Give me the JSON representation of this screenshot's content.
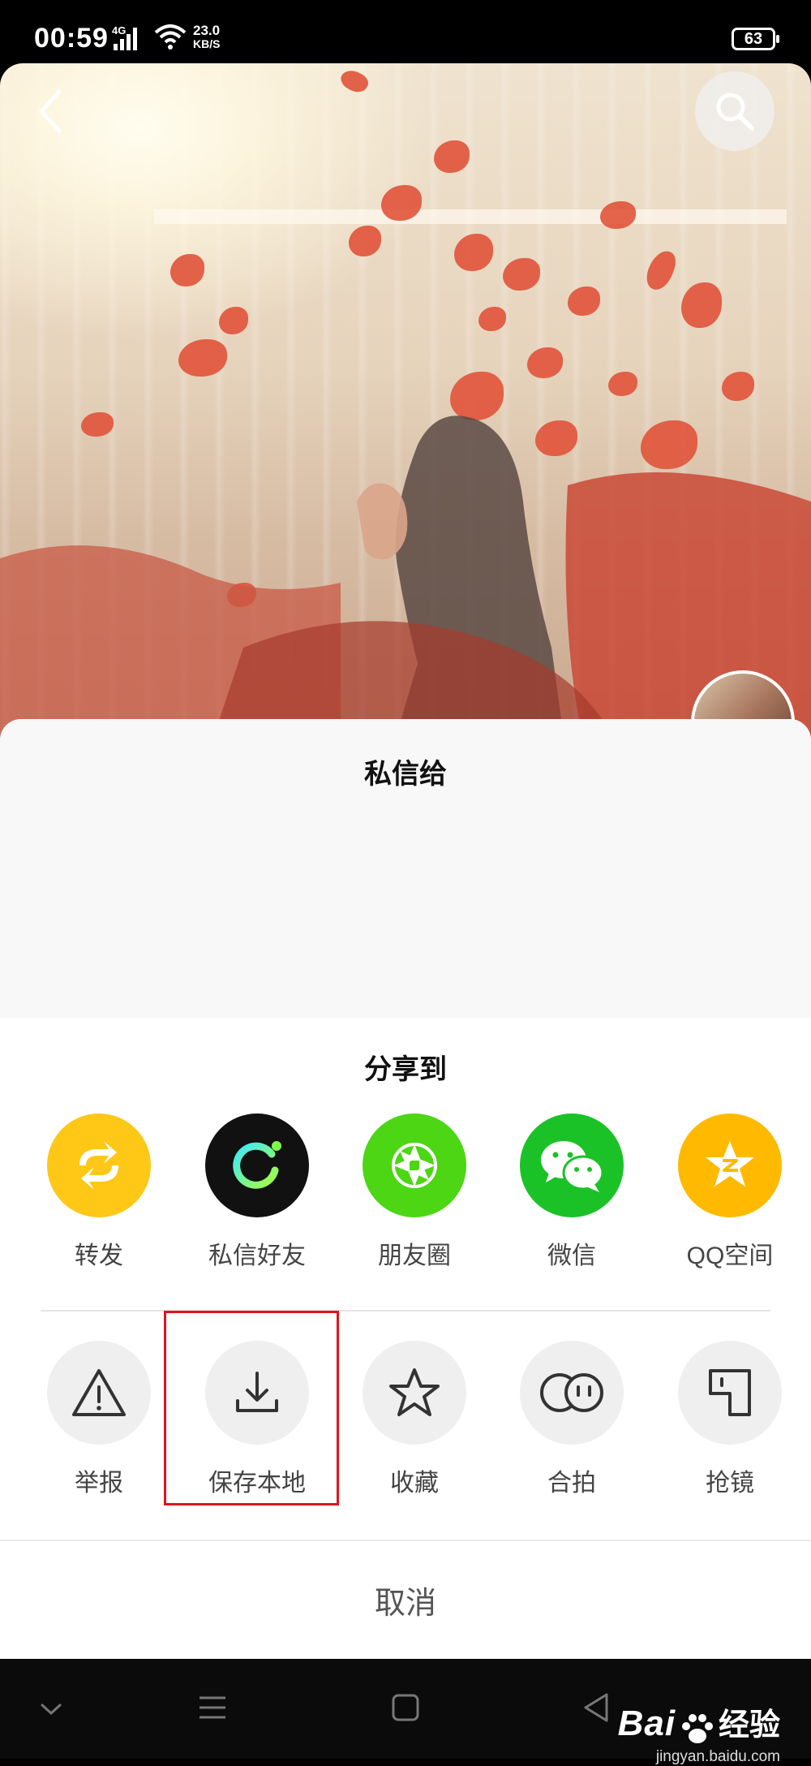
{
  "status_bar": {
    "time": "00:59",
    "network": "4G",
    "speed_value": "23.0",
    "speed_unit": "KB/S",
    "battery": "63"
  },
  "video": {
    "back_icon": "back-arrow-icon",
    "search_icon": "search-icon"
  },
  "dm_section": {
    "title": "私信给"
  },
  "share_section": {
    "title": "分享到",
    "targets": [
      {
        "label": "转发",
        "icon": "repost-icon",
        "color": "#FFC716"
      },
      {
        "label": "私信好友",
        "icon": "message-friend-icon",
        "color": "#111111"
      },
      {
        "label": "朋友圈",
        "icon": "moments-icon",
        "color": "#4CD614"
      },
      {
        "label": "微信",
        "icon": "wechat-icon",
        "color": "#1BC227"
      },
      {
        "label": "QQ空间",
        "icon": "qzone-icon",
        "color": "#FFBA00"
      }
    ]
  },
  "actions": [
    {
      "label": "举报",
      "icon": "warning-icon"
    },
    {
      "label": "保存本地",
      "icon": "download-icon"
    },
    {
      "label": "收藏",
      "icon": "star-icon"
    },
    {
      "label": "合拍",
      "icon": "duet-icon"
    },
    {
      "label": "抢镜",
      "icon": "stitch-icon"
    }
  ],
  "highlight_color": "#E0141E",
  "cancel_label": "取消",
  "watermark": {
    "brand_a": "Bai",
    "brand_b": "经验",
    "url": "jingyan.baidu.com"
  }
}
